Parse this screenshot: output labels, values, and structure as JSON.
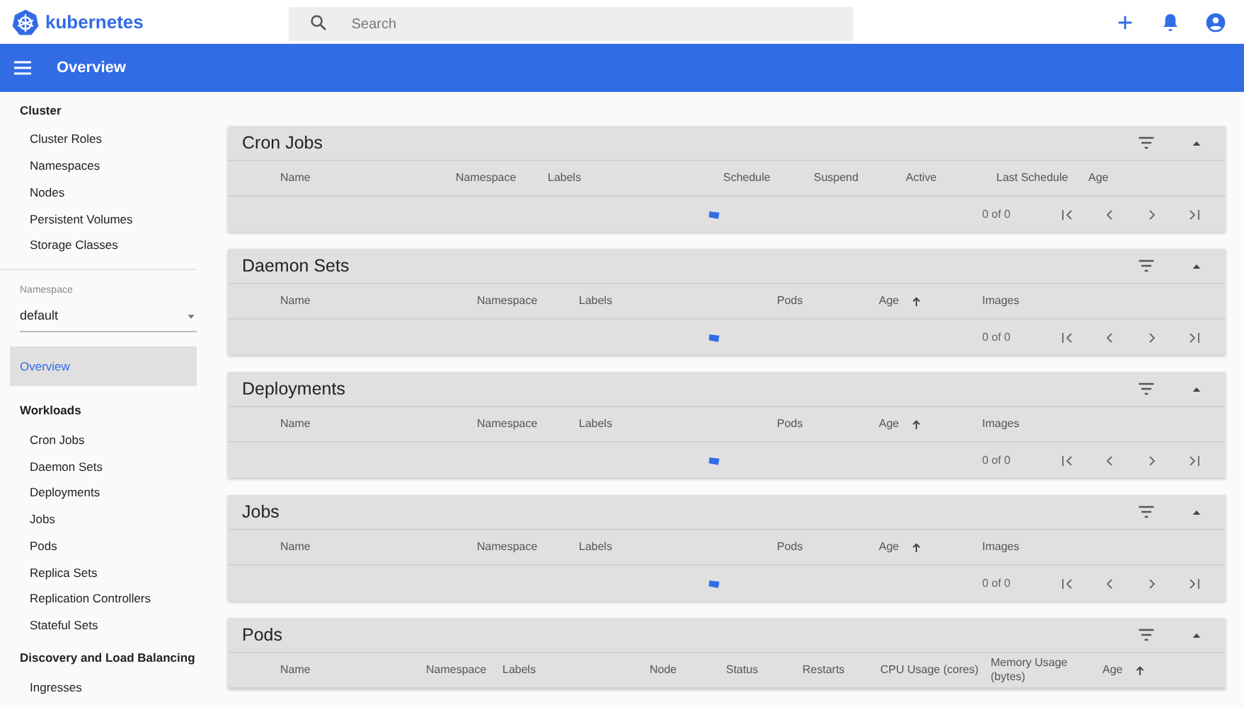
{
  "header": {
    "brand": "kubernetes",
    "search": {
      "placeholder": "Search"
    }
  },
  "toolbar": {
    "title": "Overview"
  },
  "sidebar": {
    "sections": [
      {
        "kind": "group",
        "title": "Cluster",
        "items": [
          {
            "label": "Cluster Roles",
            "selected": false
          },
          {
            "label": "Namespaces",
            "selected": false
          },
          {
            "label": "Nodes",
            "selected": false
          },
          {
            "label": "Persistent Volumes",
            "selected": false
          },
          {
            "label": "Storage Classes",
            "selected": false
          }
        ]
      },
      {
        "kind": "namespace",
        "label": "Namespace",
        "value": "default"
      },
      {
        "kind": "link",
        "label": "Overview",
        "selected": true
      },
      {
        "kind": "group",
        "title": "Workloads",
        "items": [
          {
            "label": "Cron Jobs",
            "selected": false
          },
          {
            "label": "Daemon Sets",
            "selected": false
          },
          {
            "label": "Deployments",
            "selected": false
          },
          {
            "label": "Jobs",
            "selected": false
          },
          {
            "label": "Pods",
            "selected": false
          },
          {
            "label": "Replica Sets",
            "selected": false
          },
          {
            "label": "Replication Controllers",
            "selected": false
          },
          {
            "label": "Stateful Sets",
            "selected": false
          }
        ]
      },
      {
        "kind": "group",
        "title": "Discovery and Load Balancing",
        "items": [
          {
            "label": "Ingresses",
            "selected": false
          }
        ]
      }
    ]
  },
  "cards": [
    {
      "title": "Cron Jobs",
      "columns": [
        {
          "label": "Name",
          "sorted": false
        },
        {
          "label": "Namespace",
          "sorted": false
        },
        {
          "label": "Labels",
          "sorted": false
        },
        {
          "label": "Schedule",
          "sorted": false
        },
        {
          "label": "Suspend",
          "sorted": false
        },
        {
          "label": "Active",
          "sorted": false
        },
        {
          "label": "Last Schedule",
          "sorted": false
        },
        {
          "label": "Age",
          "sorted": false
        }
      ],
      "footer": {
        "range": "0 of 0"
      }
    },
    {
      "title": "Daemon Sets",
      "columns": [
        {
          "label": "Name",
          "sorted": false
        },
        {
          "label": "Namespace",
          "sorted": false
        },
        {
          "label": "Labels",
          "sorted": false
        },
        {
          "label": "Pods",
          "sorted": false
        },
        {
          "label": "Age",
          "sorted": true
        },
        {
          "label": "Images",
          "sorted": false
        }
      ],
      "footer": {
        "range": "0 of 0"
      }
    },
    {
      "title": "Deployments",
      "columns": [
        {
          "label": "Name",
          "sorted": false
        },
        {
          "label": "Namespace",
          "sorted": false
        },
        {
          "label": "Labels",
          "sorted": false
        },
        {
          "label": "Pods",
          "sorted": false
        },
        {
          "label": "Age",
          "sorted": true
        },
        {
          "label": "Images",
          "sorted": false
        }
      ],
      "footer": {
        "range": "0 of 0"
      }
    },
    {
      "title": "Jobs",
      "columns": [
        {
          "label": "Name",
          "sorted": false
        },
        {
          "label": "Namespace",
          "sorted": false
        },
        {
          "label": "Labels",
          "sorted": false
        },
        {
          "label": "Pods",
          "sorted": false
        },
        {
          "label": "Age",
          "sorted": true
        },
        {
          "label": "Images",
          "sorted": false
        }
      ],
      "footer": {
        "range": "0 of 0"
      }
    },
    {
      "title": "Pods",
      "columns": [
        {
          "label": "Name",
          "sorted": false
        },
        {
          "label": "Namespace",
          "sorted": false
        },
        {
          "label": "Labels",
          "sorted": false
        },
        {
          "label": "Node",
          "sorted": false
        },
        {
          "label": "Status",
          "sorted": false
        },
        {
          "label": "Restarts",
          "sorted": false
        },
        {
          "label": "CPU Usage (cores)",
          "sorted": false
        },
        {
          "label": "Memory Usage (bytes)",
          "sorted": false
        },
        {
          "label": "Age",
          "sorted": true
        }
      ]
    }
  ]
}
